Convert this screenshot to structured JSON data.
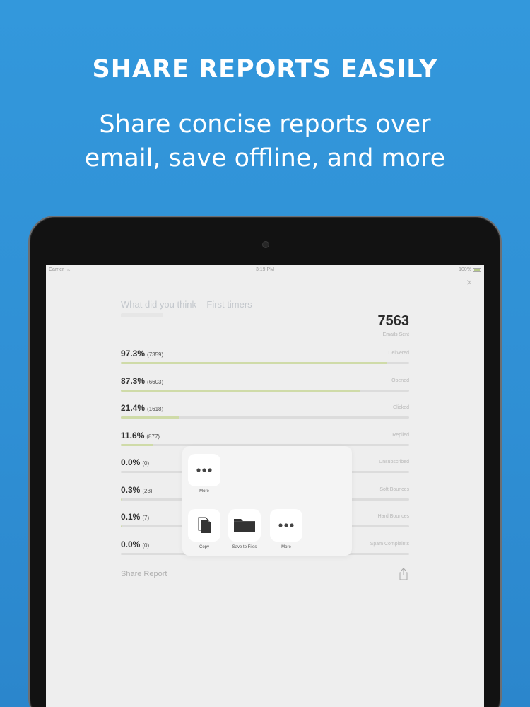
{
  "promo": {
    "headline": "SHARE REPORTS EASILY",
    "subline_1": "Share concise reports over",
    "subline_2": "email, save offline, and more"
  },
  "status_bar": {
    "carrier": "Carrier",
    "time": "3:19 PM",
    "battery": "100%"
  },
  "report": {
    "campaign_title": "What did you think – First timers",
    "emails_sent": "7563",
    "emails_sent_label": "Emails Sent",
    "metrics": [
      {
        "pct": "97.3%",
        "count": "(7359)",
        "label": "Delivered",
        "fraction": 0.973
      },
      {
        "pct": "87.3%",
        "count": "(6603)",
        "label": "Opened",
        "fraction": 0.873
      },
      {
        "pct": "21.4%",
        "count": "(1618)",
        "label": "Clicked",
        "fraction": 0.214
      },
      {
        "pct": "11.6%",
        "count": "(877)",
        "label": "Replied",
        "fraction": 0.116
      },
      {
        "pct": "0.0%",
        "count": "(0)",
        "label": "Unsubscribed",
        "fraction": 0.0
      },
      {
        "pct": "0.3%",
        "count": "(23)",
        "label": "Soft Bounces",
        "fraction": 0.003
      },
      {
        "pct": "0.1%",
        "count": "(7)",
        "label": "Hard Bounces",
        "fraction": 0.001
      },
      {
        "pct": "0.0%",
        "count": "(0)",
        "label": "Spam Complaints",
        "fraction": 0.0
      }
    ],
    "share_label": "Share Report"
  },
  "share_sheet": {
    "top_row": [
      {
        "label": "More",
        "icon": "more-icon"
      }
    ],
    "bottom_row": [
      {
        "label": "Copy",
        "icon": "copy-icon"
      },
      {
        "label": "Save to Files",
        "icon": "folder-icon"
      },
      {
        "label": "More",
        "icon": "more-icon"
      }
    ]
  },
  "colors": {
    "background": "#3398dc",
    "progress_fill": "#cfdba8"
  }
}
